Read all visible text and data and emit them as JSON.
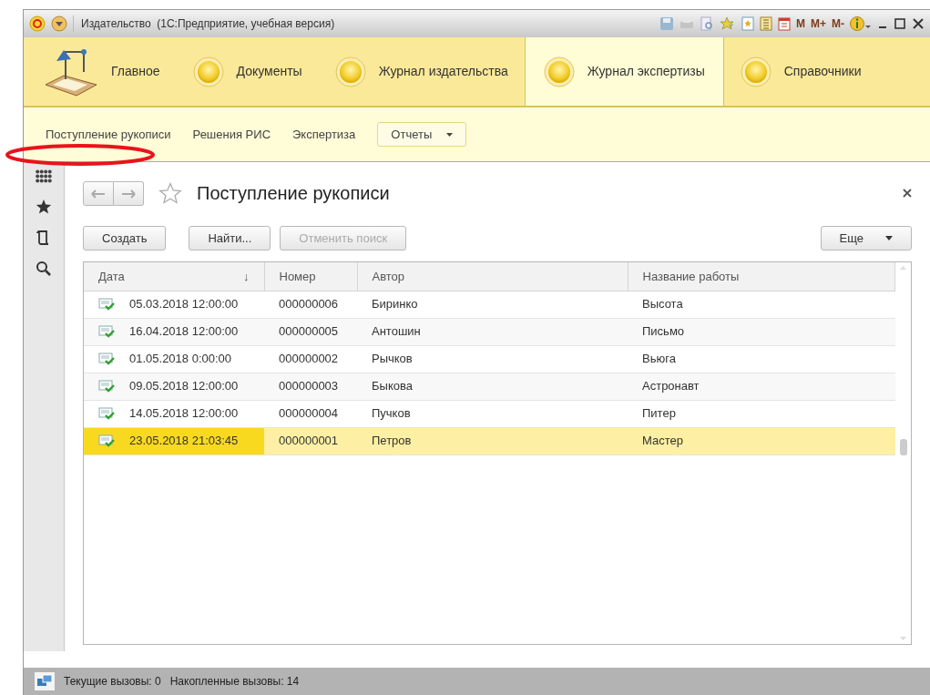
{
  "window": {
    "title": "Издательство  (1С:Предприятие, учебная версия)",
    "memory_buttons": [
      "M",
      "M+",
      "M-"
    ]
  },
  "sections": [
    {
      "label": "Главное",
      "kind": "home",
      "selected": false
    },
    {
      "label": "Документы",
      "kind": "section",
      "selected": false
    },
    {
      "label": "Журнал издательства",
      "kind": "section",
      "selected": false
    },
    {
      "label": "Журнал экспертизы",
      "kind": "section",
      "selected": true
    },
    {
      "label": "Справочники",
      "kind": "section",
      "selected": false
    }
  ],
  "subnav": [
    {
      "label": "Поступление рукописи",
      "kind": "link"
    },
    {
      "label": "Решения РИС",
      "kind": "link"
    },
    {
      "label": "Экспертиза",
      "kind": "link"
    },
    {
      "label": "Отчеты",
      "kind": "dropdown"
    }
  ],
  "form": {
    "title": "Поступление рукописи",
    "buttons": [
      {
        "label": "Создать",
        "disabled": false
      },
      {
        "label": "Найти...",
        "disabled": false
      },
      {
        "label": "Отменить поиск",
        "disabled": true
      }
    ],
    "more_button": "Еще"
  },
  "table": {
    "columns": [
      {
        "label": "Дата",
        "sort": "↓"
      },
      {
        "label": "Номер"
      },
      {
        "label": "Автор"
      },
      {
        "label": "Название работы"
      }
    ],
    "rows": [
      {
        "cells": [
          "05.03.2018 12:00:00",
          "000000006",
          "Биринко",
          "Высота"
        ],
        "selected": false
      },
      {
        "cells": [
          "16.04.2018 12:00:00",
          "000000005",
          "Антошин",
          "Письмо"
        ],
        "selected": false
      },
      {
        "cells": [
          "01.05.2018 0:00:00",
          "000000002",
          "Рычков",
          "Вьюга"
        ],
        "selected": false
      },
      {
        "cells": [
          "09.05.2018 12:00:00",
          "000000003",
          "Быкова",
          "Астронавт"
        ],
        "selected": false
      },
      {
        "cells": [
          "14.05.2018 12:00:00",
          "000000004",
          "Пучков",
          "Питер"
        ],
        "selected": false
      },
      {
        "cells": [
          "23.05.2018 21:03:45",
          "000000001",
          "Петров",
          "Мастер"
        ],
        "selected": true
      }
    ]
  },
  "status_bar": [
    "Текущие вызовы: 0",
    "Накопленные вызовы: 14"
  ]
}
